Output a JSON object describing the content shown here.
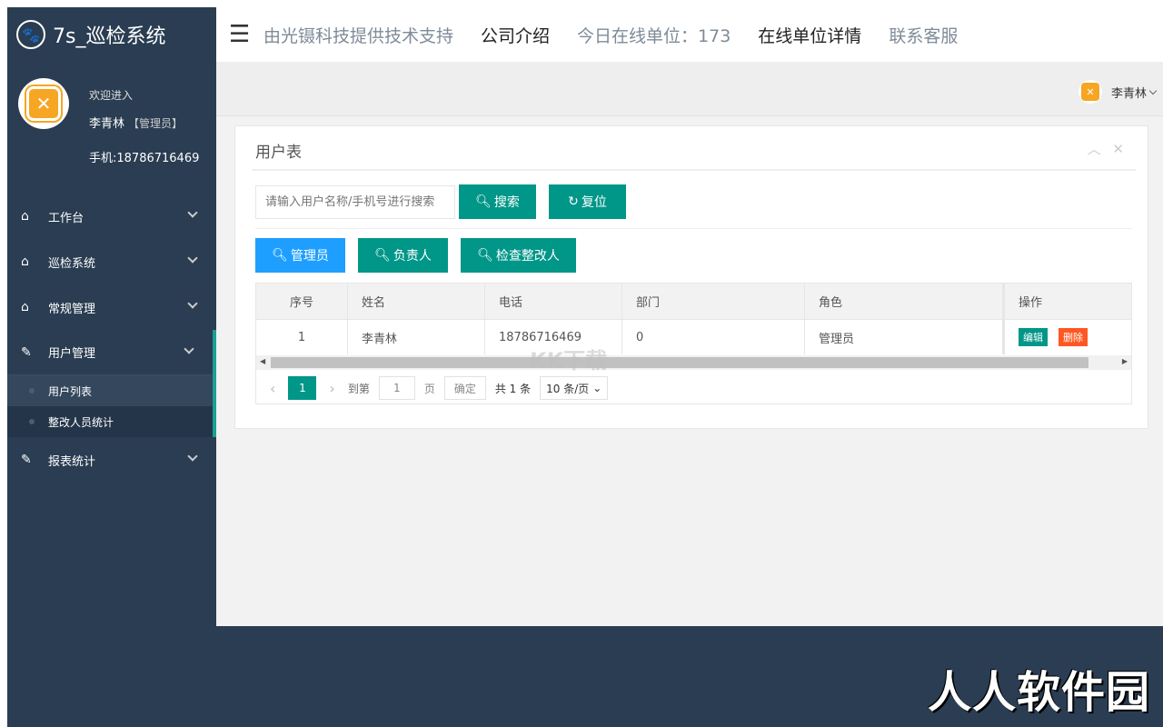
{
  "brand": {
    "title": "7s_巡检系统",
    "logo_icon": "paw-icon"
  },
  "profile": {
    "welcome": "欢迎进入",
    "name": "李青林",
    "role": "【管理员】",
    "phone": "手机:18786716469"
  },
  "sidebar": {
    "items": [
      {
        "label": "工作台",
        "icon": "home-icon"
      },
      {
        "label": "巡检系统",
        "icon": "home-icon"
      },
      {
        "label": "常规管理",
        "icon": "home-icon"
      },
      {
        "label": "用户管理",
        "icon": "edit-icon",
        "sub": [
          {
            "label": "用户列表"
          },
          {
            "label": "整改人员统计"
          }
        ]
      },
      {
        "label": "报表统计",
        "icon": "edit-icon"
      }
    ]
  },
  "topbar": {
    "menu_icon": "hamburger-icon",
    "links": [
      "由光镊科技提供技术支持",
      "公司介绍",
      "今日在线单位：173",
      "在线单位详情",
      "联系客服"
    ]
  },
  "userbar": {
    "name": "李青林"
  },
  "panel": {
    "title": "用户表",
    "search_placeholder": "请输入用户名称/手机号进行搜索",
    "search_btn": "搜索",
    "reset_btn": "复位",
    "role_btns": [
      "管理员",
      "负责人",
      "检查整改人"
    ]
  },
  "table": {
    "headers": [
      "序号",
      "姓名",
      "电话",
      "部门",
      "角色",
      "操作"
    ],
    "rows": [
      {
        "no": "1",
        "name": "李青林",
        "phone": "18786716469",
        "dept": "0",
        "role": "管理员"
      }
    ],
    "edit": "编辑",
    "delete": "删除"
  },
  "pager": {
    "current": "1",
    "goto": "到第",
    "page_input": "1",
    "page": "页",
    "confirm": "确定",
    "total": "共 1 条",
    "per_page": "10 条/页"
  },
  "watermarks": {
    "kk": "KK下载",
    "site": "人人软件园"
  }
}
